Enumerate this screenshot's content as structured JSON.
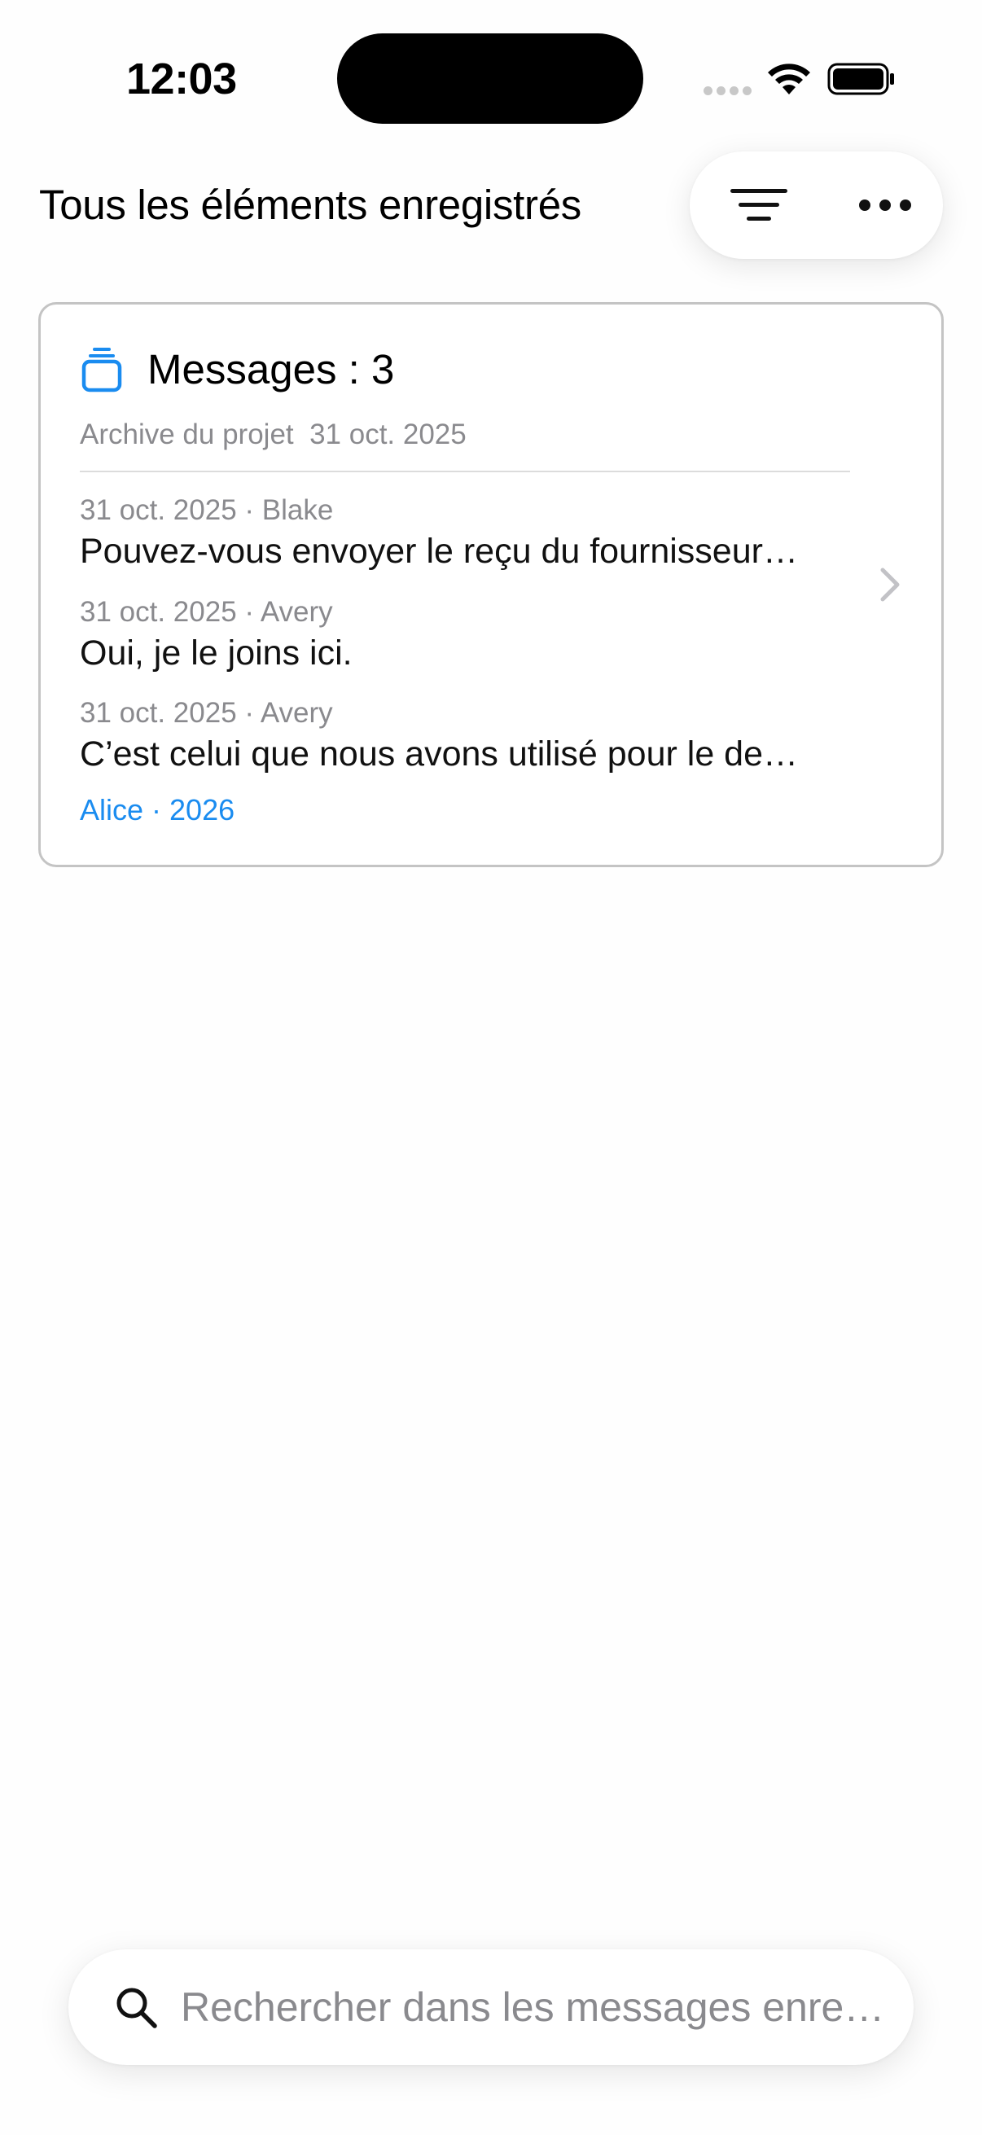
{
  "status_bar": {
    "time": "12:03"
  },
  "header": {
    "title": "Tous les éléments enregistrés",
    "filter_icon": "filter-lines-icon",
    "more_icon": "ellipsis-icon"
  },
  "card": {
    "icon": "stack-icon",
    "title": "Messages : 3",
    "subtitle": "Archive du projet  31 oct. 2025",
    "messages": [
      {
        "meta": "31 oct. 2025 · Blake",
        "text": "Pouvez-vous envoyer le reçu du fournisseur…"
      },
      {
        "meta": "31 oct. 2025 · Avery",
        "text": "Oui, je le joins ici."
      },
      {
        "meta": "31 oct. 2025 · Avery",
        "text": "C’est celui que nous avons utilisé pour le de…"
      }
    ],
    "footer": "Alice · 2026"
  },
  "search": {
    "placeholder": "Rechercher dans les messages enre…",
    "value": ""
  },
  "colors": {
    "accent": "#1a8cf0",
    "secondary_text": "#8a8a8e",
    "card_border": "#c4c4c4"
  }
}
